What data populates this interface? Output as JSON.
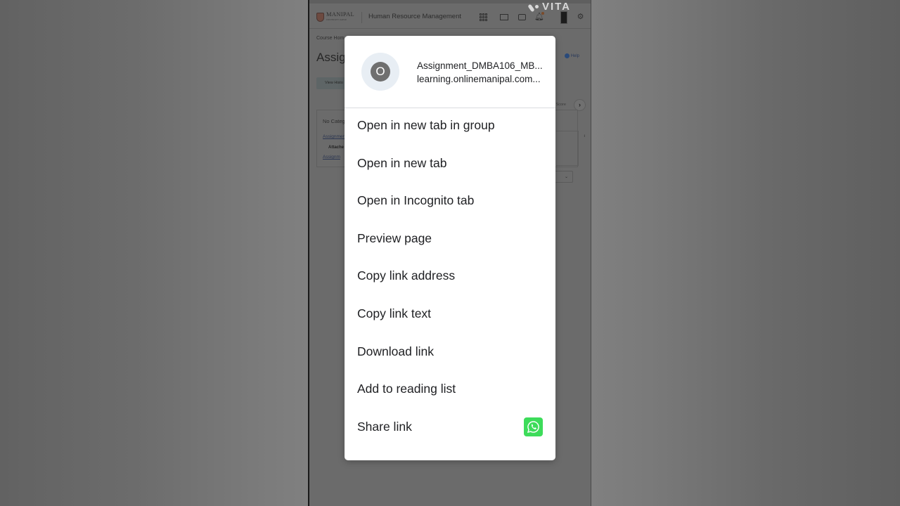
{
  "watermark": {
    "text": "VITA"
  },
  "background_page": {
    "logo": {
      "name": "MANIPAL",
      "subtitle": "UNIVERSITY JAIPUR"
    },
    "course_title": "Human Resource Management",
    "nav_icons": [
      "grid-icon",
      "mail-icon",
      "chat-icon",
      "bell-icon",
      "avatar",
      "gear-icon"
    ],
    "breadcrumb": "Course Hom",
    "page_heading": "Assign",
    "help_label": "Help",
    "view_button": "View Histo",
    "score_header": "Score",
    "next_arrow": "›",
    "table": {
      "category": "No Categ",
      "assignment_link": "Assignmen",
      "attachments_label": "Attache",
      "file_link": "Assignm"
    },
    "select_chevron": "⌄"
  },
  "context_menu": {
    "header": {
      "favicon_letter": "O",
      "link_title": "Assignment_DMBA106_MB...",
      "link_url": "learning.onlinemanipal.com..."
    },
    "items": [
      {
        "label": "Open in new tab in group"
      },
      {
        "label": "Open in new tab"
      },
      {
        "label": "Open in Incognito tab"
      },
      {
        "label": "Preview page"
      },
      {
        "label": "Copy link address"
      },
      {
        "label": "Copy link text"
      },
      {
        "label": "Download link"
      },
      {
        "label": "Add to reading list"
      },
      {
        "label": "Share link",
        "icon": "whatsapp-icon"
      }
    ]
  },
  "colors": {
    "menu_background": "#ffffff",
    "menu_text": "#202124",
    "whatsapp_green": "#3ddc5a",
    "favicon_bg": "#6f6f6f",
    "scrim": "#6b6b6b"
  }
}
